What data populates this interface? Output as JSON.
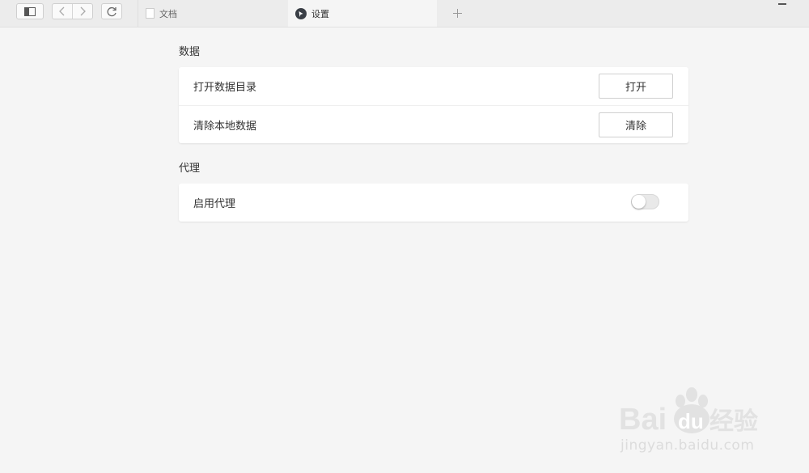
{
  "tabs": [
    {
      "label": "文档",
      "icon": "document-icon",
      "active": false
    },
    {
      "label": "设置",
      "icon": "settings-app-icon",
      "active": true
    }
  ],
  "toolbar": {
    "icons": [
      "sidebar-toggle-icon",
      "back-icon",
      "forward-icon",
      "refresh-icon",
      "new-tab-icon",
      "minimize-icon"
    ]
  },
  "sections": [
    {
      "title": "数据",
      "rows": [
        {
          "label": "打开数据目录",
          "button": "打开"
        },
        {
          "label": "清除本地数据",
          "button": "清除"
        }
      ]
    },
    {
      "title": "代理",
      "rows": [
        {
          "label": "启用代理",
          "toggle": false
        }
      ]
    }
  ],
  "watermark": {
    "brand_a": "Bai",
    "brand_b": "du",
    "brand_c": "经验",
    "url": "jingyan.baidu.com"
  },
  "colors": {
    "background": "#f5f5f5",
    "card": "#ffffff",
    "topbar": "#ececec",
    "watermark": "#dcdcdc"
  }
}
